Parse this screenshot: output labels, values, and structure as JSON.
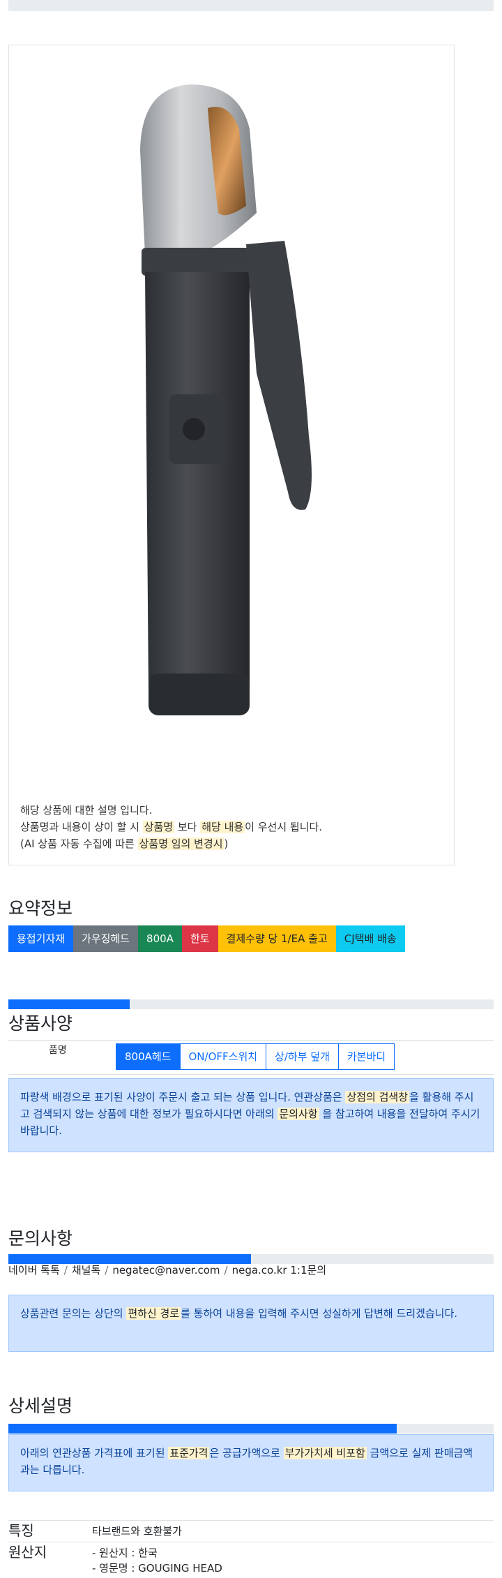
{
  "product": {
    "image_icon": "gouging-head-holder-image",
    "description_line1": "해당 상품에 대한 설명 입니다.",
    "description_line2_a": "상품명과 내용이 상이 할 시 ",
    "description_line2_hl1": "상품명",
    "description_line2_b": " 보다 ",
    "description_line2_hl2": "해당 내용",
    "description_line2_c": "이 우선시 됩니다.",
    "description_line3_a": "(AI 상품 자동 수집에 따른 ",
    "description_line3_hl": "상품명 임의 변경시",
    "description_line3_b": ")"
  },
  "summary": {
    "title": "요약정보",
    "badges": [
      {
        "label": "용접기자재",
        "color": "#0d6efd"
      },
      {
        "label": "가우징헤드",
        "color": "#6c757d"
      },
      {
        "label": "800A",
        "color": "#198754"
      },
      {
        "label": "한토",
        "color": "#dc3545"
      },
      {
        "label": "결제수량 당 1/EA 출고",
        "color": "#ffc107",
        "text_color": "#212529"
      },
      {
        "label": "CJ택배 배송",
        "color": "#0dcaf0",
        "text_color": "#212529"
      }
    ]
  },
  "spec": {
    "progress": 0.25,
    "title": "상품사양",
    "label": "품명",
    "options": [
      "800A헤드",
      "ON/OFF스위치",
      "상/하부 덮개",
      "카본바디"
    ],
    "selected": "800A헤드",
    "notice_a": "파랑색 배경으로 표기된 사양이 주문시 출고 되는 상품 입니다. 연관상품은 ",
    "notice_hl1": "상점의 검색창",
    "notice_b": "을 활용해 주시고 검색되지 않는 상품에 대한 정보가 필요하시다면 아래의 ",
    "notice_hl2": "문의사항",
    "notice_c": " 을 참고하여 내용을 전달하여 주시기 바랍니다."
  },
  "inquiry": {
    "title": "문의사항",
    "progress": 0.5,
    "channels": [
      "네이버 톡톡",
      "채널톡",
      "negatec@naver.com",
      "nega.co.kr 1:1문의"
    ],
    "notice_a": "상품관련 문의는 상단의 ",
    "notice_hl": "편하신 경로",
    "notice_b": "를 통하여 내용을 입력해 주시면 성실하게 답변해 드리겠습니다."
  },
  "detail": {
    "title": "상세설명",
    "progress": 0.8,
    "notice_a": "아래의 연관상품 가격표에 표기된 ",
    "notice_hl1": "표준가격",
    "notice_b": "은 공급가액으로 ",
    "notice_hl2": "부가가치세 비포함",
    "notice_c": " 금액으로 실제 판매금액과는 다릅니다.",
    "attributes": [
      {
        "key": "특징",
        "values": [
          "타브랜드와 호환불가"
        ]
      },
      {
        "key": "원산지",
        "values": [
          "- 원산지 : 한국",
          "- 영문명 : GOUGING HEAD"
        ]
      }
    ]
  }
}
